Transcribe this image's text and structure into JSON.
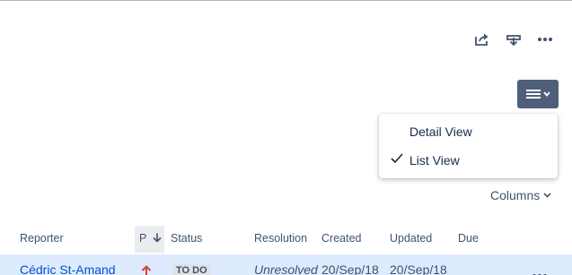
{
  "toolbar": {
    "share_icon": "share-icon",
    "export_icon": "export-icon",
    "more_icon": "more-icon"
  },
  "view_switcher": {
    "icon": "list-menu-icon",
    "options": [
      {
        "label": "Detail View",
        "selected": false
      },
      {
        "label": "List View",
        "selected": true
      }
    ]
  },
  "columns_button": {
    "label": "Columns"
  },
  "table": {
    "headers": {
      "reporter": "Reporter",
      "priority": "P",
      "status": "Status",
      "resolution": "Resolution",
      "created": "Created",
      "updated": "Updated",
      "due": "Due"
    },
    "rows": [
      {
        "reporter": "Cédric St-Amand",
        "priority": "high",
        "status": "TO DO",
        "resolution": "Unresolved",
        "created": "20/Sep/18",
        "updated": "20/Sep/18",
        "due": ""
      }
    ]
  },
  "colors": {
    "accent": "#505F79",
    "link": "#0052CC",
    "row_highlight": "#DEEBFF",
    "priority_high": "#D04437",
    "text": "#172B4D"
  }
}
